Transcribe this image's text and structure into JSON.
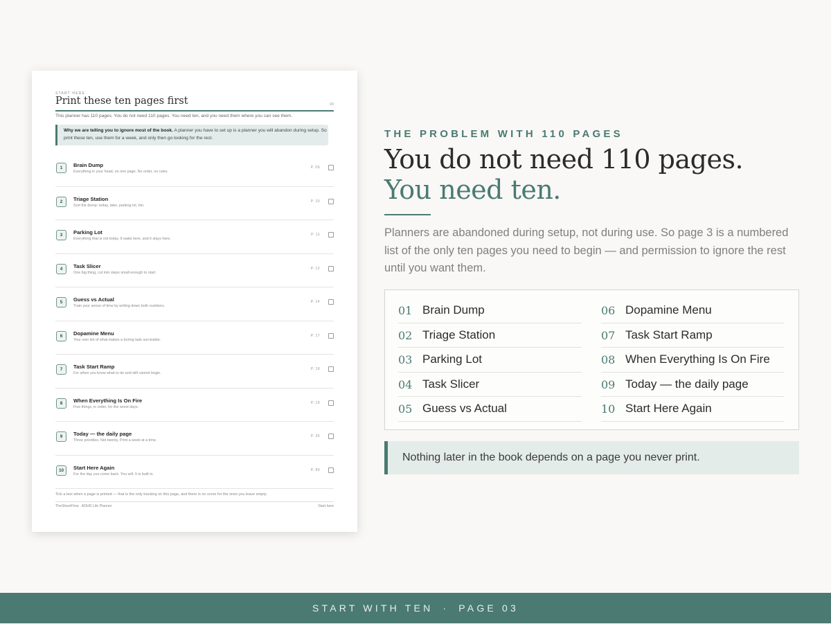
{
  "sheet": {
    "eyebrow": "START HERE",
    "title": "Print these ten pages first",
    "page_number": "03",
    "intro": "This planner has 110 pages. You do not need 110 pages. You need ten, and you need them where you can see them.",
    "callout_bold": "Why we are telling you to ignore most of the book.",
    "callout_text": " A planner you have to set up is a planner you will abandon during setup. So print these ten, use them for a week, and only then go looking for the rest.",
    "items": [
      {
        "num": "1",
        "name": "Brain Dump",
        "sub": "Everything in your head, on one page. No order, no rules.",
        "page": "P. 09"
      },
      {
        "num": "2",
        "name": "Triage Station",
        "sub": "Sort the dump: today, later, parking lot, bin.",
        "page": "P. 10"
      },
      {
        "num": "3",
        "name": "Parking Lot",
        "sub": "Everything that is not today. It waits here, and it stays here.",
        "page": "P. 11"
      },
      {
        "num": "4",
        "name": "Task Slicer",
        "sub": "One big thing, cut into steps small enough to start.",
        "page": "P. 12"
      },
      {
        "num": "5",
        "name": "Guess vs Actual",
        "sub": "Train your sense of time by writing down both numbers.",
        "page": "P. 14"
      },
      {
        "num": "6",
        "name": "Dopamine Menu",
        "sub": "Your own list of what makes a boring task survivable.",
        "page": "P. 17"
      },
      {
        "num": "7",
        "name": "Task Start Ramp",
        "sub": "For when you know what to do and still cannot begin.",
        "page": "P. 18"
      },
      {
        "num": "8",
        "name": "When Everything Is On Fire",
        "sub": "Five things, in order, for the worst days.",
        "page": "P. 19"
      },
      {
        "num": "9",
        "name": "Today — the daily page",
        "sub": "Three priorities. Not twenty. Print a week at a time.",
        "page": "P. 35"
      },
      {
        "num": "10",
        "name": "Start Here Again",
        "sub": "For the day you come back. You will. It is built in.",
        "page": "P. 89"
      }
    ],
    "note": "Tick a box when a page is printed — that is the only tracking on this page, and there is no score for the ones you leave empty.",
    "footer_left": "TheSheetFlow · ADHD Life Planner",
    "footer_right": "Start here"
  },
  "content": {
    "kicker": "THE PROBLEM WITH 110 PAGES",
    "headline_1": "You do not need 110 pages.",
    "headline_2": "You need ten.",
    "body": "Planners are abandoned during setup, not during use. So page 3 is a numbered list of the only ten pages you need to begin — and permission to ignore the rest until you want them.",
    "toc": [
      {
        "num": "01",
        "label": "Brain Dump"
      },
      {
        "num": "02",
        "label": "Triage Station"
      },
      {
        "num": "03",
        "label": "Parking Lot"
      },
      {
        "num": "04",
        "label": "Task Slicer"
      },
      {
        "num": "05",
        "label": "Guess vs Actual"
      },
      {
        "num": "06",
        "label": "Dopamine Menu"
      },
      {
        "num": "07",
        "label": "Task Start Ramp"
      },
      {
        "num": "08",
        "label": "When Everything Is On Fire"
      },
      {
        "num": "09",
        "label": "Today — the daily page"
      },
      {
        "num": "10",
        "label": "Start Here Again"
      }
    ],
    "quote": "Nothing later in the book depends on a page you never print."
  },
  "footer": {
    "left": "START WITH TEN",
    "separator": "·",
    "right": "PAGE 03"
  },
  "colors": {
    "accent": "#4a7a72",
    "background": "#f9f8f6",
    "callout_bg": "#e4ecea"
  }
}
